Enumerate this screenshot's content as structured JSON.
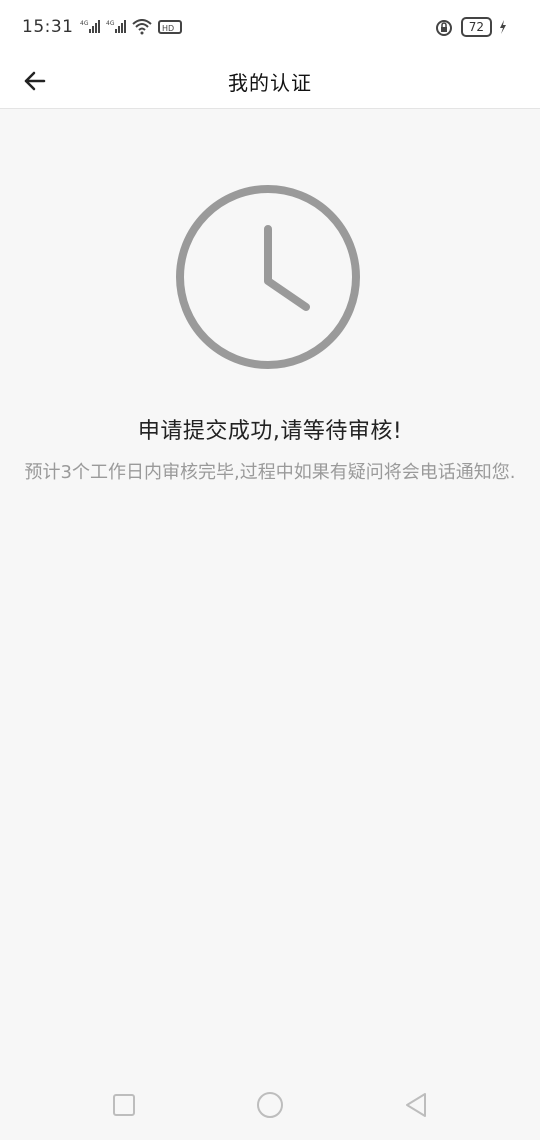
{
  "status_bar": {
    "time": "15:31",
    "battery": "72"
  },
  "header": {
    "title": "我的认证"
  },
  "main": {
    "title": "申请提交成功,请等待审核!",
    "description": "预计3个工作日内审核完毕,过程中如果有疑问将会电话通知您."
  }
}
